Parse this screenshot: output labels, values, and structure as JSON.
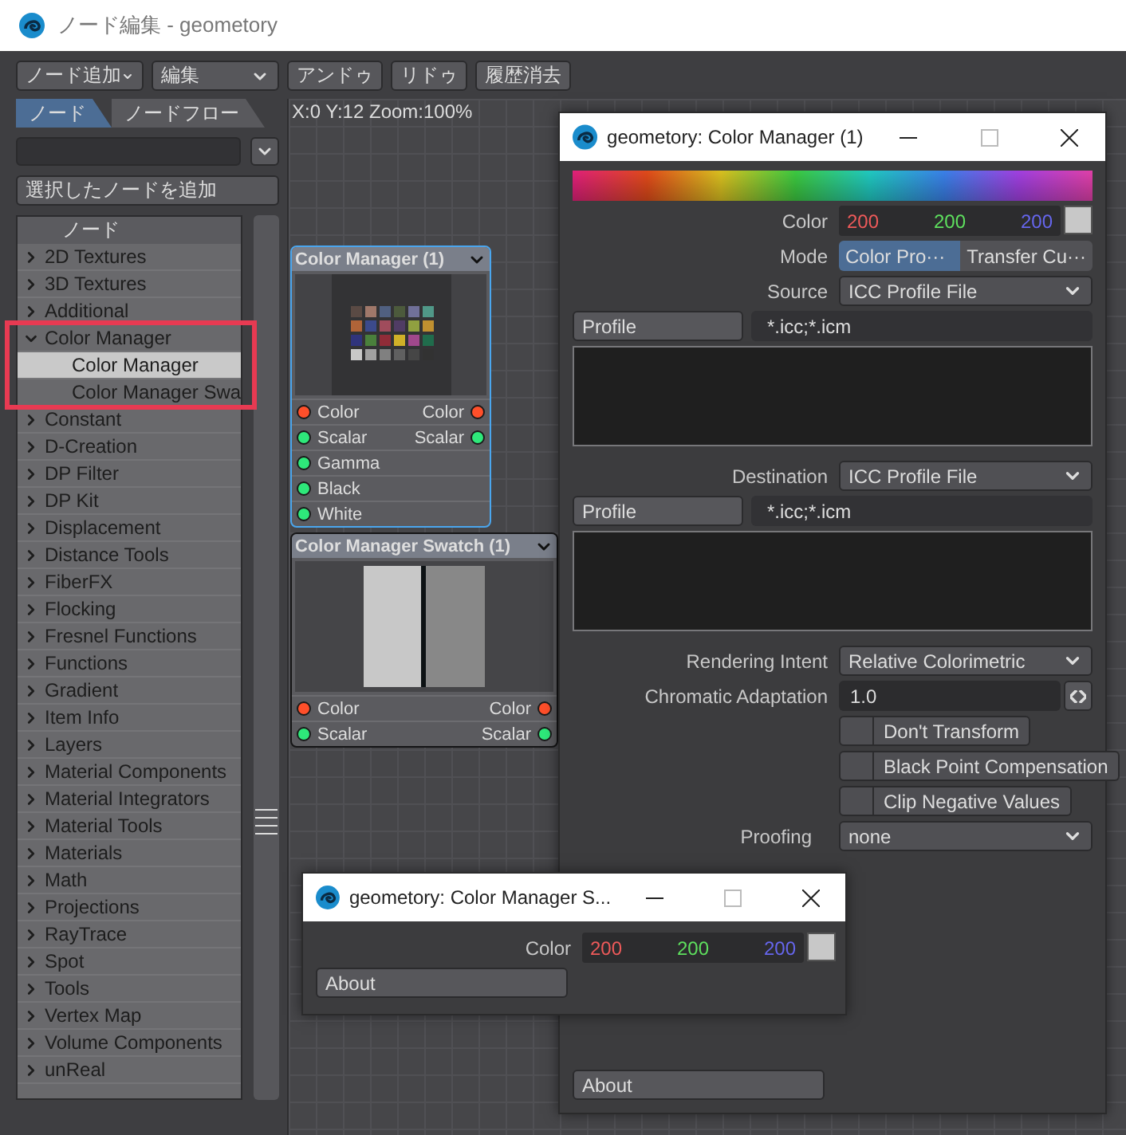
{
  "window": {
    "title": "ノード編集 - geometory"
  },
  "toolbar": {
    "menus": [
      "ノード追加",
      "編集"
    ],
    "buttons": [
      "アンドゥ",
      "リドゥ",
      "履歴消去"
    ]
  },
  "sidebar": {
    "tabs": [
      {
        "label": "ノード",
        "selected": true
      },
      {
        "label": "ノードフロー",
        "selected": false
      }
    ],
    "add_button": "選択したノードを追加",
    "list_header": "ノード",
    "items": [
      {
        "label": "2D Textures",
        "expanded": false,
        "selected": false
      },
      {
        "label": "3D Textures",
        "expanded": false,
        "selected": false
      },
      {
        "label": "Additional",
        "expanded": false,
        "selected": false
      },
      {
        "label": "Color Manager",
        "expanded": true,
        "selected": false,
        "highlighted": true,
        "children": [
          {
            "label": "Color Manager",
            "selected": true
          },
          {
            "label": "Color Manager Swa",
            "selected": false
          }
        ]
      },
      {
        "label": "Constant",
        "expanded": false,
        "selected": false
      },
      {
        "label": "D-Creation",
        "expanded": false,
        "selected": false
      },
      {
        "label": "DP Filter",
        "expanded": false,
        "selected": false
      },
      {
        "label": "DP Kit",
        "expanded": false,
        "selected": false
      },
      {
        "label": "Displacement",
        "expanded": false,
        "selected": false
      },
      {
        "label": "Distance Tools",
        "expanded": false,
        "selected": false
      },
      {
        "label": "FiberFX",
        "expanded": false,
        "selected": false
      },
      {
        "label": "Flocking",
        "expanded": false,
        "selected": false
      },
      {
        "label": "Fresnel Functions",
        "expanded": false,
        "selected": false
      },
      {
        "label": "Functions",
        "expanded": false,
        "selected": false
      },
      {
        "label": "Gradient",
        "expanded": false,
        "selected": false
      },
      {
        "label": "Item Info",
        "expanded": false,
        "selected": false
      },
      {
        "label": "Layers",
        "expanded": false,
        "selected": false
      },
      {
        "label": "Material Components",
        "expanded": false,
        "selected": false
      },
      {
        "label": "Material Integrators",
        "expanded": false,
        "selected": false
      },
      {
        "label": "Material Tools",
        "expanded": false,
        "selected": false
      },
      {
        "label": "Materials",
        "expanded": false,
        "selected": false
      },
      {
        "label": "Math",
        "expanded": false,
        "selected": false
      },
      {
        "label": "Projections",
        "expanded": false,
        "selected": false
      },
      {
        "label": "RayTrace",
        "expanded": false,
        "selected": false
      },
      {
        "label": "Spot",
        "expanded": false,
        "selected": false
      },
      {
        "label": "Tools",
        "expanded": false,
        "selected": false
      },
      {
        "label": "Vertex Map",
        "expanded": false,
        "selected": false
      },
      {
        "label": "Volume Components",
        "expanded": false,
        "selected": false
      },
      {
        "label": "unReal",
        "expanded": false,
        "selected": false
      }
    ]
  },
  "canvas": {
    "status": "X:0 Y:12 Zoom:100%",
    "nodes": [
      {
        "title": "Color Manager (1)",
        "selected": true,
        "kind": "checker",
        "ports": [
          {
            "input": {
              "label": "Color",
              "color": "#ff4f2a"
            },
            "output": {
              "label": "Color",
              "color": "#ff4f2a"
            }
          },
          {
            "input": {
              "label": "Scalar",
              "color": "#2ee87a"
            },
            "output": {
              "label": "Scalar",
              "color": "#2ee87a"
            }
          },
          {
            "input": {
              "label": "Gamma",
              "color": "#2ee87a"
            }
          },
          {
            "input": {
              "label": "Black",
              "color": "#2ee87a"
            }
          },
          {
            "input": {
              "label": "White",
              "color": "#2ee87a"
            }
          }
        ]
      },
      {
        "title": "Color Manager Swatch (1)",
        "selected": false,
        "kind": "swatch",
        "ports": [
          {
            "input": {
              "label": "Color",
              "color": "#ff4f2a"
            },
            "output": {
              "label": "Color",
              "color": "#ff4f2a"
            }
          },
          {
            "input": {
              "label": "Scalar",
              "color": "#2ee87a"
            },
            "output": {
              "label": "Scalar",
              "color": "#2ee87a"
            }
          }
        ]
      }
    ]
  },
  "color_manager": {
    "title": "geometory: Color Manager (1)",
    "color": {
      "label": "Color",
      "values": [
        "200",
        "200",
        "200"
      ]
    },
    "mode": {
      "label": "Mode",
      "options": [
        {
          "label": "Color Pro···",
          "selected": true
        },
        {
          "label": "Transfer Cu···",
          "selected": false
        }
      ]
    },
    "source": {
      "label": "Source",
      "value": "ICC Profile File",
      "profile_button": "Profile",
      "profile_path": "*.icc;*.icm"
    },
    "destination": {
      "label": "Destination",
      "value": "ICC Profile File",
      "profile_button": "Profile",
      "profile_path": "*.icc;*.icm"
    },
    "rendering_intent": {
      "label": "Rendering Intent",
      "value": "Relative Colorimetric"
    },
    "chromatic_adaptation": {
      "label": "Chromatic Adaptation",
      "value": "1.0"
    },
    "toggles": [
      {
        "label": "Don't Transform",
        "checked": false
      },
      {
        "label": "Black Point Compensation",
        "checked": false
      },
      {
        "label": "Clip Negative Values",
        "checked": false
      }
    ],
    "proofing": {
      "label": "Proofing",
      "value": "none"
    },
    "about_button": "About"
  },
  "swatch_window": {
    "title": "geometory: Color Manager S...",
    "color": {
      "label": "Color",
      "values": [
        "200",
        "200",
        "200"
      ]
    },
    "about_button": "About"
  }
}
